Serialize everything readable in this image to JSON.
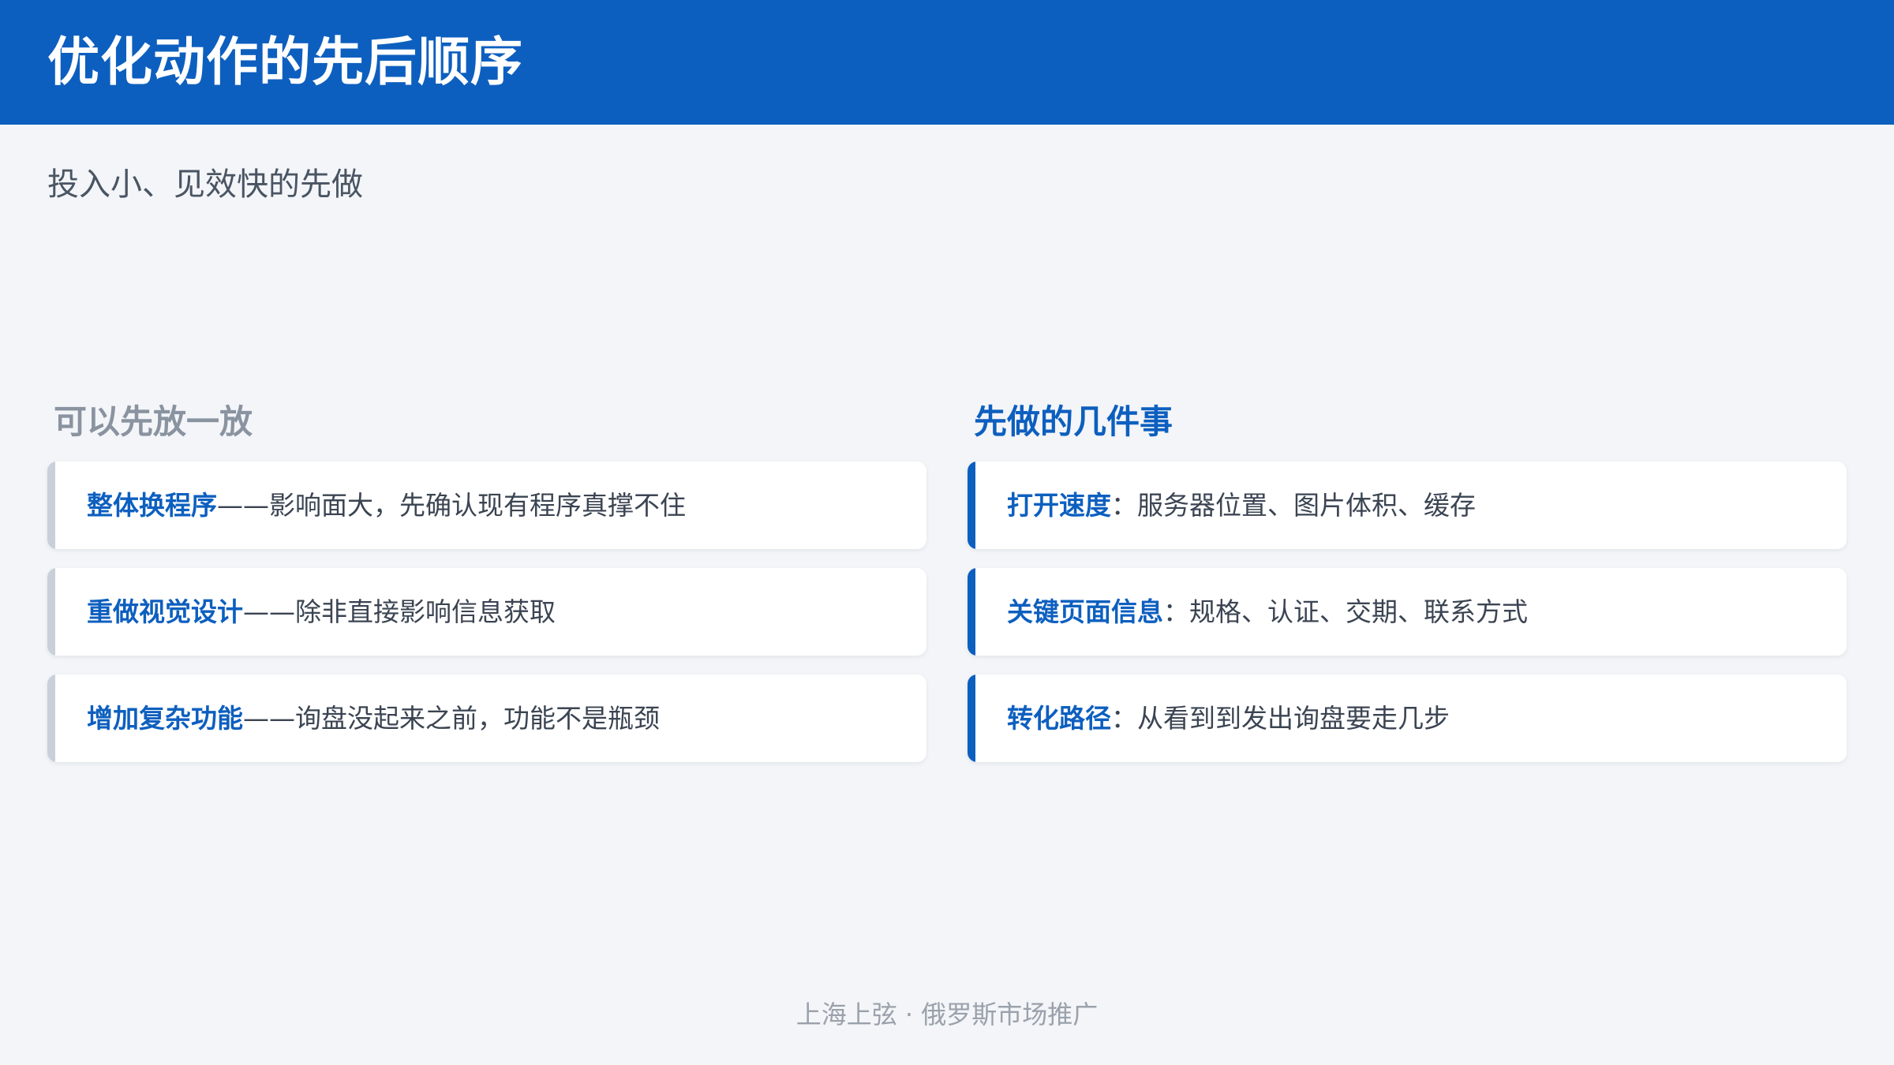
{
  "header": {
    "title": "优化动作的先后顺序"
  },
  "subtitle": "投入小、见效快的先做",
  "left_section": {
    "heading": "可以先放一放",
    "items": [
      {
        "strong": "整体换程序",
        "sep": "——",
        "text": "影响面大，先确认现有程序真撑不住"
      },
      {
        "strong": "重做视觉设计",
        "sep": "——",
        "text": "除非直接影响信息获取"
      },
      {
        "strong": "增加复杂功能",
        "sep": "——",
        "text": "询盘没起来之前，功能不是瓶颈"
      }
    ]
  },
  "right_section": {
    "heading": "先做的几件事",
    "items": [
      {
        "strong": "打开速度",
        "sep": "：",
        "text": "服务器位置、图片体积、缓存"
      },
      {
        "strong": "关键页面信息",
        "sep": "：",
        "text": "规格、认证、交期、联系方式"
      },
      {
        "strong": "转化路径",
        "sep": "：",
        "text": "从看到到发出询盘要走几步"
      }
    ]
  },
  "footer": {
    "text": "上海上弦 · 俄罗斯市场推广"
  },
  "colors": {
    "brand_blue": "#0D5FBF",
    "background": "#F3F5F8",
    "muted_accent": "#C9D0DA"
  }
}
